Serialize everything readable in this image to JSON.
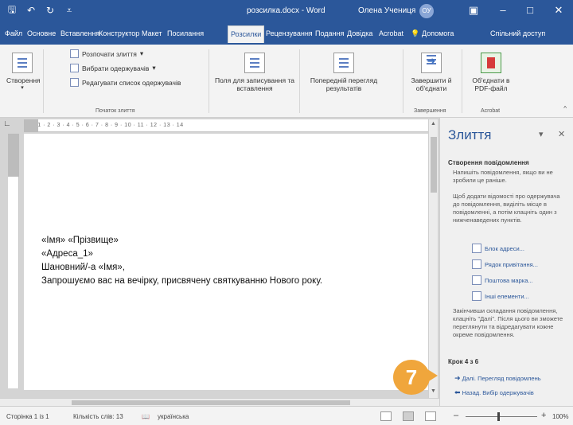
{
  "window": {
    "title": "розсилка.docx - Word",
    "user": "Олена Учениця",
    "avatar_initials": "ОУ"
  },
  "ribbon_tabs": [
    "Файл",
    "Основне",
    "Вставлення",
    "Конструктор",
    "Макет",
    "Посилання",
    "Розсилки",
    "Рецензування",
    "Подання",
    "Довідка",
    "Acrobat",
    "Допомога",
    "Спільний доступ"
  ],
  "active_tab": "Розсилки",
  "ribbon": {
    "start": "Створення",
    "merge_items": [
      "Розпочати злиття",
      "Вибрати одержувачів",
      "Редагувати список одержувачів"
    ],
    "merge_group_label": "Початок злиття",
    "write_fields": "Поля для записування та вставлення",
    "preview": "Попередній перегляд результатів",
    "finish": "Завершити й об'єднати",
    "finish_group_label": "Завершення",
    "acrobat": "Об'єднати в PDF-файл",
    "acrobat_group_label": "Acrobat"
  },
  "ruler": {
    "marks": "· 1 · 2 · 3 · 4 · 5 · 6 · 7 · 8 · 9 · 10 · 11 · 12 · 13 · 14"
  },
  "document": {
    "lines": [
      "«Імя» «Прізвище»",
      "«Адреса_1»",
      "Шановний/-а «Імя»,",
      "Запрошуємо вас на вечірку, присвячену святкуванню Нового року."
    ]
  },
  "pane": {
    "title": "Злиття",
    "section_heading": "Створення повідомлення",
    "intro": "Напишіть повідомлення, якщо ви не зробили це раніше.",
    "instructions": "Щоб додати відомості про одержувача до повідомлення, виділіть місце в повідомленні, а потім клацніть один з нижченаведених пунктів.",
    "links": [
      "Блок адреси...",
      "Рядок привітання...",
      "Поштова марка...",
      "Інші елементи..."
    ],
    "after_text": "Закінчивши складання повідомлення, клацніть \"Далі\". Після цього ви зможете переглянути та відредагувати кожне окреме повідомлення.",
    "step": "Крок 4 з 6",
    "next": "Далі. Перегляд повідомлень",
    "back": "Назад. Вибір одержувачів"
  },
  "callout": "7",
  "status": {
    "page": "Сторінка 1 із 1",
    "words": "Кількість слів: 13",
    "language": "українська",
    "zoom": "100%"
  },
  "colors": {
    "accent": "#2b579a",
    "callout": "#f0a63c"
  }
}
